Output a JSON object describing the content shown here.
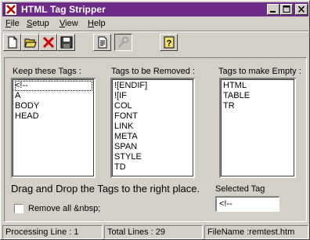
{
  "window": {
    "title": "HTML Tag Stripper"
  },
  "menu": [
    {
      "label": "File",
      "key": "F",
      "rest": "ile"
    },
    {
      "label": "Setup",
      "key": "S",
      "rest": "etup"
    },
    {
      "label": "View",
      "key": "V",
      "rest": "iew"
    },
    {
      "label": "Help",
      "key": "H",
      "rest": "elp"
    }
  ],
  "toolbar": [
    "new-document-icon",
    "open-folder-icon",
    "delete-x-icon",
    "save-disk-icon",
    "view-document-icon",
    "tools-icon",
    "help-question-icon"
  ],
  "keep": {
    "label": "Keep these Tags :",
    "items": [
      "<!--",
      "A",
      "BODY",
      "HEAD"
    ]
  },
  "remove": {
    "label": "Tags to be Removed :",
    "items": [
      "![ENDIF]",
      "![IF",
      "COL",
      "FONT",
      "LINK",
      "META",
      "SPAN",
      "STYLE",
      "TD"
    ]
  },
  "empty": {
    "label": "Tags to make Empty :",
    "items": [
      "HTML",
      "TABLE",
      "TR"
    ]
  },
  "instruction": "Drag and Drop the Tags to the right place.",
  "remove_nbsp": {
    "label": "Remove all &nbsp;",
    "checked": false
  },
  "selected_tag": {
    "label": "Selected Tag",
    "value": "<!--"
  },
  "status": {
    "processing": "Processing Line : 1",
    "total": "Total Lines : 29",
    "filename": "FileName :remtest.htm"
  }
}
